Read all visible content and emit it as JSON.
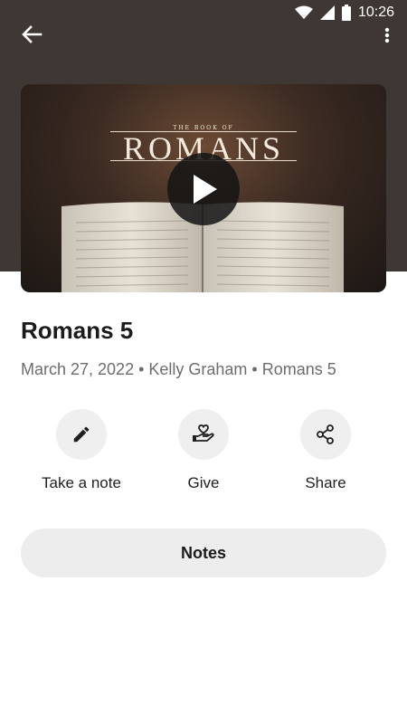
{
  "status_bar": {
    "time": "10:26"
  },
  "video": {
    "small_title": "THE BOOK OF",
    "title": "ROMANS"
  },
  "message": {
    "title": "Romans 5",
    "meta": "March 27, 2022 • Kelly Graham • Romans 5"
  },
  "actions": [
    {
      "label": "Take a note",
      "icon": "pencil-icon"
    },
    {
      "label": "Give",
      "icon": "heart-hand-icon"
    },
    {
      "label": "Share",
      "icon": "share-icon"
    }
  ],
  "notes_button": {
    "label": "Notes"
  },
  "colors": {
    "header_bg": "#3e3734",
    "action_circle": "#efefef",
    "notes_button_bg": "#ededed",
    "meta_text": "#6d6d6d"
  }
}
